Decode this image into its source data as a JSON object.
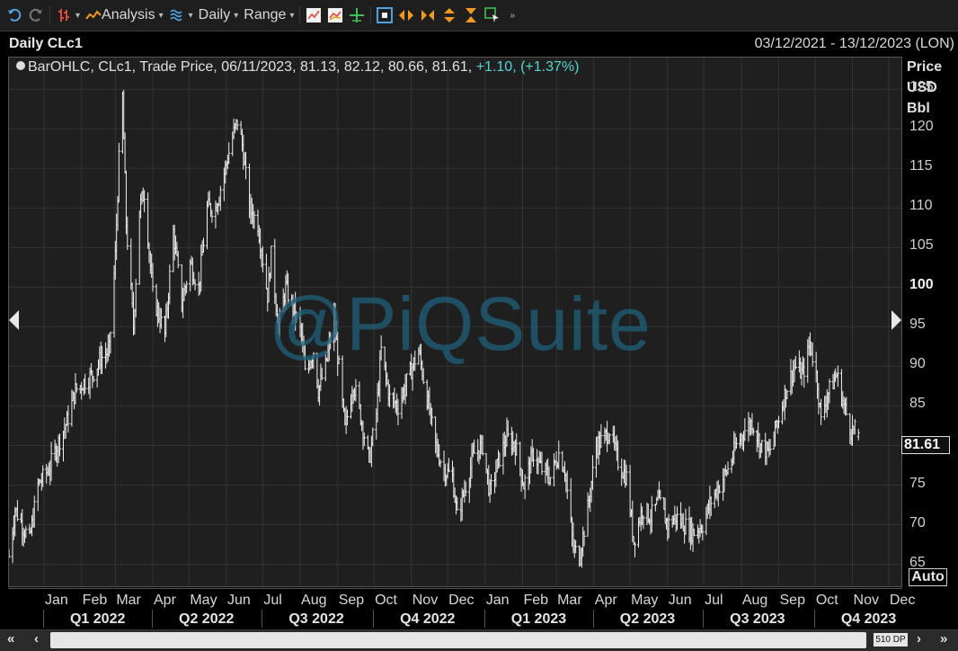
{
  "toolbar": {
    "analysis_label": "Analysis",
    "interval_label": "Daily",
    "range_label": "Range"
  },
  "header": {
    "title": "Daily CLc1",
    "date_range": "03/12/2021 - 13/12/2023 (LON)"
  },
  "legend": {
    "text": "BarOHLC, CLc1, Trade Price, 06/11/2023, 81.13, 82.12, 80.66, 81.61,",
    "change": "+1.10, (+1.37%)"
  },
  "watermark": "@PiQSuite",
  "axis": {
    "unit_lines": [
      "Price",
      "USD",
      "Bbl"
    ],
    "last_value": "81.61",
    "auto_label": "Auto",
    "dp_label": "510 DP"
  },
  "chart_data": {
    "type": "bar",
    "subtype": "ohlc",
    "instrument": "CLc1",
    "interval": "Daily",
    "ylim": [
      62,
      129
    ],
    "yticks": [
      65,
      70,
      75,
      80,
      85,
      90,
      95,
      100,
      105,
      110,
      115,
      120,
      125
    ],
    "ytick_bold": [
      100
    ],
    "months": [
      "Jan",
      "Feb",
      "Mar",
      "Apr",
      "May",
      "Jun",
      "Jul",
      "Aug",
      "Sep",
      "Oct",
      "Nov",
      "Dec",
      "Jan",
      "Feb",
      "Mar",
      "Apr",
      "May",
      "Jun",
      "Jul",
      "Aug",
      "Sep",
      "Oct",
      "Nov",
      "Dec"
    ],
    "quarters": [
      "Q1 2022",
      "Q2 2022",
      "Q3 2022",
      "Q4 2022",
      "Q1 2023",
      "Q2 2023",
      "Q3 2023",
      "Q4 2023"
    ],
    "x_start": "2021-12-03",
    "x_end": "2023-12-13",
    "last_bar": {
      "date": "06/11/2023",
      "open": 81.13,
      "high": 82.12,
      "low": 80.66,
      "close": 81.61
    },
    "series_path": [
      [
        "2021-12-03",
        66
      ],
      [
        "2021-12-08",
        72
      ],
      [
        "2021-12-14",
        70
      ],
      [
        "2021-12-20",
        68
      ],
      [
        "2021-12-27",
        75
      ],
      [
        "2022-01-05",
        77
      ],
      [
        "2022-01-12",
        80
      ],
      [
        "2022-01-20",
        83
      ],
      [
        "2022-01-27",
        87
      ],
      [
        "2022-02-03",
        88
      ],
      [
        "2022-02-10",
        89
      ],
      [
        "2022-02-17",
        91
      ],
      [
        "2022-02-24",
        92
      ],
      [
        "2022-03-01",
        104
      ],
      [
        "2022-03-04",
        116
      ],
      [
        "2022-03-07",
        124
      ],
      [
        "2022-03-10",
        108
      ],
      [
        "2022-03-16",
        95
      ],
      [
        "2022-03-21",
        110
      ],
      [
        "2022-03-25",
        112
      ],
      [
        "2022-04-01",
        99
      ],
      [
        "2022-04-07",
        96
      ],
      [
        "2022-04-11",
        94
      ],
      [
        "2022-04-18",
        107
      ],
      [
        "2022-04-25",
        98
      ],
      [
        "2022-05-02",
        103
      ],
      [
        "2022-05-09",
        100
      ],
      [
        "2022-05-16",
        110
      ],
      [
        "2022-05-23",
        110
      ],
      [
        "2022-05-31",
        115
      ],
      [
        "2022-06-06",
        119
      ],
      [
        "2022-06-10",
        121
      ],
      [
        "2022-06-14",
        118
      ],
      [
        "2022-06-20",
        110
      ],
      [
        "2022-06-27",
        108
      ],
      [
        "2022-07-05",
        99
      ],
      [
        "2022-07-08",
        104
      ],
      [
        "2022-07-14",
        95
      ],
      [
        "2022-07-20",
        100
      ],
      [
        "2022-07-27",
        97
      ],
      [
        "2022-08-02",
        94
      ],
      [
        "2022-08-05",
        89
      ],
      [
        "2022-08-12",
        92
      ],
      [
        "2022-08-16",
        87
      ],
      [
        "2022-08-22",
        90
      ],
      [
        "2022-08-29",
        96
      ],
      [
        "2022-09-07",
        82
      ],
      [
        "2022-09-14",
        88
      ],
      [
        "2022-09-21",
        83
      ],
      [
        "2022-09-27",
        78
      ],
      [
        "2022-10-03",
        84
      ],
      [
        "2022-10-07",
        92
      ],
      [
        "2022-10-14",
        86
      ],
      [
        "2022-10-21",
        85
      ],
      [
        "2022-10-28",
        88
      ],
      [
        "2022-11-07",
        92
      ],
      [
        "2022-11-14",
        86
      ],
      [
        "2022-11-21",
        80
      ],
      [
        "2022-11-28",
        77
      ],
      [
        "2022-12-05",
        76
      ],
      [
        "2022-12-09",
        71
      ],
      [
        "2022-12-16",
        75
      ],
      [
        "2022-12-23",
        79
      ],
      [
        "2022-12-30",
        80
      ],
      [
        "2023-01-05",
        74
      ],
      [
        "2023-01-12",
        78
      ],
      [
        "2023-01-19",
        81
      ],
      [
        "2023-01-26",
        80
      ],
      [
        "2023-02-02",
        75
      ],
      [
        "2023-02-10",
        79
      ],
      [
        "2023-02-17",
        77
      ],
      [
        "2023-02-24",
        76
      ],
      [
        "2023-03-03",
        79
      ],
      [
        "2023-03-08",
        77
      ],
      [
        "2023-03-15",
        67
      ],
      [
        "2023-03-20",
        66
      ],
      [
        "2023-03-27",
        72
      ],
      [
        "2023-04-03",
        80
      ],
      [
        "2023-04-10",
        81
      ],
      [
        "2023-04-14",
        82
      ],
      [
        "2023-04-21",
        78
      ],
      [
        "2023-04-28",
        76
      ],
      [
        "2023-05-04",
        68
      ],
      [
        "2023-05-11",
        72
      ],
      [
        "2023-05-18",
        71
      ],
      [
        "2023-05-25",
        73
      ],
      [
        "2023-06-01",
        70
      ],
      [
        "2023-06-08",
        71
      ],
      [
        "2023-06-15",
        70
      ],
      [
        "2023-06-22",
        69
      ],
      [
        "2023-06-30",
        70
      ],
      [
        "2023-07-07",
        73
      ],
      [
        "2023-07-14",
        75
      ],
      [
        "2023-07-21",
        77
      ],
      [
        "2023-07-28",
        80
      ],
      [
        "2023-08-04",
        82
      ],
      [
        "2023-08-10",
        83
      ],
      [
        "2023-08-17",
        80
      ],
      [
        "2023-08-24",
        79
      ],
      [
        "2023-08-31",
        83
      ],
      [
        "2023-09-07",
        87
      ],
      [
        "2023-09-14",
        90
      ],
      [
        "2023-09-21",
        89
      ],
      [
        "2023-09-27",
        93
      ],
      [
        "2023-10-03",
        88
      ],
      [
        "2023-10-06",
        83
      ],
      [
        "2023-10-10",
        86
      ],
      [
        "2023-10-13",
        87
      ],
      [
        "2023-10-19",
        89
      ],
      [
        "2023-10-25",
        85
      ],
      [
        "2023-10-31",
        82
      ],
      [
        "2023-11-06",
        81.61
      ]
    ]
  }
}
